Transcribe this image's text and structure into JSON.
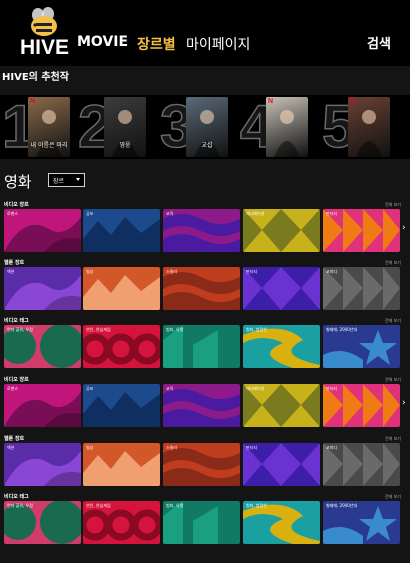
{
  "header": {
    "logo_text": "HIVE",
    "nav": {
      "movie": "MOVIE",
      "genre": "장르별",
      "mypage": "마이페이지",
      "search": "검색"
    },
    "colors": {
      "accent": "#f5c04a",
      "background": "#000000"
    }
  },
  "recommend": {
    "title": "HIVE의 추천작",
    "items": [
      {
        "rank": "1",
        "caption": "내 이름은 마리",
        "poster_color": "#8a6a4a",
        "badge": "N"
      },
      {
        "rank": "2",
        "caption": "영웅",
        "poster_color": "#3c3c3c",
        "badge": ""
      },
      {
        "rank": "3",
        "caption": "교섭",
        "poster_color": "#5a6a78",
        "badge": ""
      },
      {
        "rank": "4",
        "caption": "",
        "poster_color": "#c8c2b8",
        "badge": "N"
      },
      {
        "rank": "5",
        "caption": "",
        "poster_color": "#6a4034",
        "badge": "N"
      }
    ]
  },
  "movies": {
    "title": "영화",
    "select_value": "장르",
    "more_label": "전체 보기",
    "rows": [
      {
        "title": "비디오 장르",
        "more": "전체 보기",
        "arrow": "›",
        "tiles": [
          {
            "label": "로맨스",
            "bg": "#c0167c",
            "fg": "#7a0e56",
            "pattern": "leaf"
          },
          {
            "label": "공포",
            "bg": "#1d4a8c",
            "fg": "#0f2f60",
            "pattern": "mountain"
          },
          {
            "label": "코믹",
            "bg": "#8c1a8a",
            "fg": "#4a1aa0",
            "pattern": "wave"
          },
          {
            "label": "애니메이션",
            "bg": "#c8b21c",
            "fg": "#7a7a1e",
            "pattern": "diamond"
          },
          {
            "label": "판타지",
            "bg": "#e0327a",
            "fg": "#f07a14",
            "pattern": "triangle"
          }
        ]
      },
      {
        "title": "웹툰 장르",
        "more": "전체 보기",
        "arrow": "",
        "tiles": [
          {
            "label": "액션",
            "bg": "#5a2ca8",
            "fg": "#8a46d4",
            "pattern": "leaf"
          },
          {
            "label": "일상",
            "bg": "#d2582a",
            "fg": "#f0a070",
            "pattern": "mountain"
          },
          {
            "label": "스릴러",
            "bg": "#c03c1e",
            "fg": "#8a2a18",
            "pattern": "wave"
          },
          {
            "label": "판타지",
            "bg": "#3c1ea8",
            "fg": "#6a32d0",
            "pattern": "diamond"
          },
          {
            "label": "코미디",
            "bg": "#4a4a4a",
            "fg": "#6a6a6a",
            "pattern": "triangle"
          }
        ]
      },
      {
        "title": "비디오 태그",
        "more": "전체 보기",
        "arrow": "",
        "tiles": [
          {
            "label": "먼저 꿈꿔, 우정",
            "bg": "#d23c6a",
            "fg": "#1a6a50",
            "pattern": "circles"
          },
          {
            "label": "연인, 연습게임",
            "bg": "#d4143c",
            "fg": "#8a0a24",
            "pattern": "rings"
          },
          {
            "label": "범죄, 유명",
            "bg": "#107a64",
            "fg": "#1aa080",
            "pattern": "zigzag"
          },
          {
            "label": "범죄, 범람한",
            "bg": "#1aa0a0",
            "fg": "#d8b010",
            "pattern": "stripe"
          },
          {
            "label": "형제애, 2000년대",
            "bg": "#2a3a90",
            "fg": "#3a8ad0",
            "pattern": "star"
          }
        ]
      },
      {
        "title": "비디오 장르",
        "more": "전체 보기",
        "arrow": "›",
        "tiles": [
          {
            "label": "로맨스",
            "bg": "#c0167c",
            "fg": "#7a0e56",
            "pattern": "leaf"
          },
          {
            "label": "공포",
            "bg": "#1d4a8c",
            "fg": "#0f2f60",
            "pattern": "mountain"
          },
          {
            "label": "코믹",
            "bg": "#8c1a8a",
            "fg": "#4a1aa0",
            "pattern": "wave"
          },
          {
            "label": "애니메이션",
            "bg": "#c8b21c",
            "fg": "#7a7a1e",
            "pattern": "diamond"
          },
          {
            "label": "판타지",
            "bg": "#e0327a",
            "fg": "#f07a14",
            "pattern": "triangle"
          }
        ]
      },
      {
        "title": "웹툰 장르",
        "more": "전체 보기",
        "arrow": "",
        "tiles": [
          {
            "label": "액션",
            "bg": "#5a2ca8",
            "fg": "#8a46d4",
            "pattern": "leaf"
          },
          {
            "label": "일상",
            "bg": "#d2582a",
            "fg": "#f0a070",
            "pattern": "mountain"
          },
          {
            "label": "스릴러",
            "bg": "#c03c1e",
            "fg": "#8a2a18",
            "pattern": "wave"
          },
          {
            "label": "판타지",
            "bg": "#3c1ea8",
            "fg": "#6a32d0",
            "pattern": "diamond"
          },
          {
            "label": "코미디",
            "bg": "#4a4a4a",
            "fg": "#6a6a6a",
            "pattern": "triangle"
          }
        ]
      },
      {
        "title": "비디오 태그",
        "more": "전체 보기",
        "arrow": "",
        "tiles": [
          {
            "label": "먼저 꿈꿔, 우정",
            "bg": "#d23c6a",
            "fg": "#1a6a50",
            "pattern": "circles"
          },
          {
            "label": "연인, 연습게임",
            "bg": "#d4143c",
            "fg": "#8a0a24",
            "pattern": "rings"
          },
          {
            "label": "범죄, 유명",
            "bg": "#107a64",
            "fg": "#1aa080",
            "pattern": "zigzag"
          },
          {
            "label": "범죄, 범람한",
            "bg": "#1aa0a0",
            "fg": "#d8b010",
            "pattern": "stripe"
          },
          {
            "label": "형제애, 2000년대",
            "bg": "#2a3a90",
            "fg": "#3a8ad0",
            "pattern": "star"
          }
        ]
      }
    ]
  }
}
